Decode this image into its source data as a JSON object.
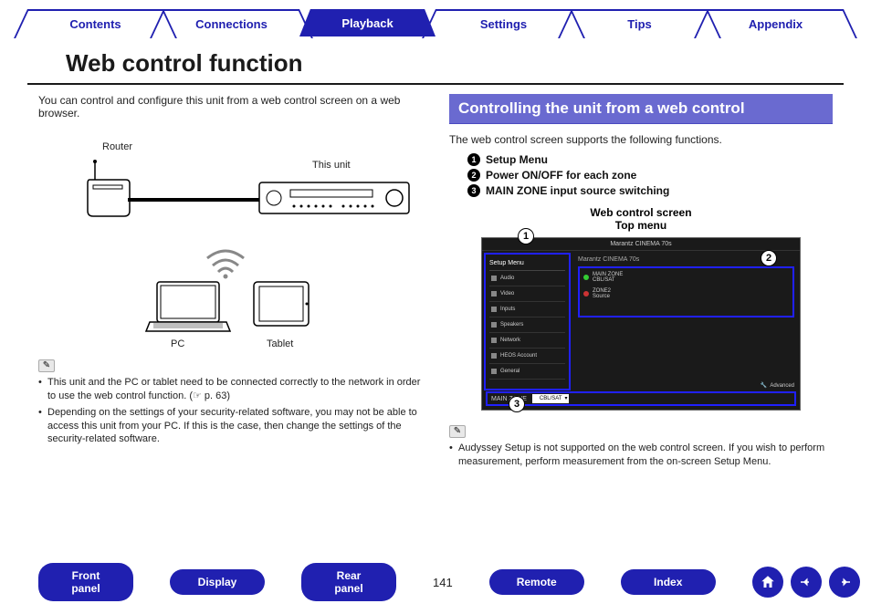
{
  "tabs": {
    "items": [
      {
        "label": "Contents"
      },
      {
        "label": "Connections"
      },
      {
        "label": "Playback"
      },
      {
        "label": "Settings"
      },
      {
        "label": "Tips"
      },
      {
        "label": "Appendix"
      }
    ],
    "activeIndex": 2
  },
  "page": {
    "title": "Web control function",
    "number": "141"
  },
  "left": {
    "intro": "You can control and configure this unit from a web control screen on a web browser.",
    "labels": {
      "router": "Router",
      "unit": "This unit",
      "pc": "PC",
      "tablet": "Tablet"
    },
    "notes": [
      "This unit and the PC or tablet need to be connected correctly to the network in order to use the web control function. (☞ p. 63)",
      "Depending on the settings of your security-related software, you may not be able to access this unit from your PC. If this is the case, then change the settings of the security-related software."
    ]
  },
  "right": {
    "heading": "Controlling the unit from a web control",
    "intro": "The web control screen supports the following functions.",
    "functions": [
      "Setup Menu",
      "Power ON/OFF for each zone",
      "MAIN ZONE input source switching"
    ],
    "screenTitle1": "Web control screen",
    "screenTitle2": "Top menu",
    "notes": [
      "Audyssey Setup is not supported on the web control screen. If you wish to perform measurement, perform measurement from the on-screen Setup Menu."
    ]
  },
  "webScreen": {
    "header": "Marantz CINEMA 70s",
    "sidebarTitle": "Setup Menu",
    "menu": [
      "Audio",
      "Video",
      "Inputs",
      "Speakers",
      "Network",
      "HEOS Account",
      "General"
    ],
    "mainTitle": "Marantz CINEMA 70s",
    "zones": [
      {
        "name": "MAIN ZONE",
        "source": "CBL/SAT",
        "state": "on"
      },
      {
        "name": "ZONE2",
        "source": "Source",
        "state": "off"
      }
    ],
    "advanced": "Advanced",
    "footerZone": "MAIN ZONE",
    "footerSource": "CBL/SAT"
  },
  "bottomNav": {
    "buttons": [
      "Front panel",
      "Display",
      "Rear panel",
      "Remote",
      "Index"
    ]
  }
}
